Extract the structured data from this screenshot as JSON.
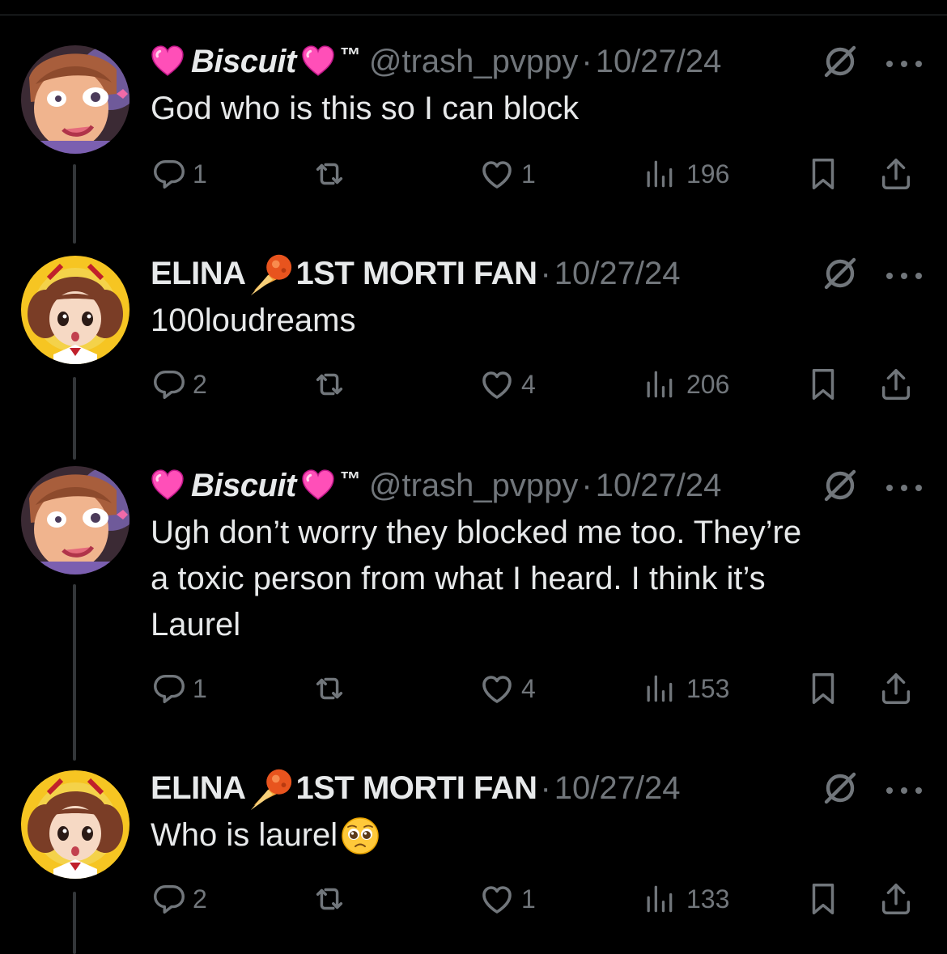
{
  "tweets": [
    {
      "author": "Biscuit",
      "author_prefix_emoji": "pink-heart",
      "author_suffix_emoji": "pink-heart",
      "tm": "™",
      "handle": "@trash_pvppy",
      "separator": "·",
      "date": "10/27/24",
      "text": "God who is this so I can block",
      "replies": "1",
      "likes": "1",
      "views": "196"
    },
    {
      "author": "ELINA",
      "author_middle_emoji": "comet",
      "author_suffix": "1ST MORTI FAN",
      "separator": "·",
      "date": "10/27/24",
      "text": "100loudreams",
      "replies": "2",
      "likes": "4",
      "views": "206"
    },
    {
      "author": "Biscuit",
      "author_prefix_emoji": "pink-heart",
      "author_suffix_emoji": "pink-heart",
      "tm": "™",
      "handle": "@trash_pvppy",
      "separator": "·",
      "date": "10/27/24",
      "text_lines": [
        "Ugh don’t worry they blocked me too. They’re",
        "a toxic person from what I heard. I think it’s",
        "Laurel"
      ],
      "replies": "1",
      "likes": "4",
      "views": "153"
    },
    {
      "author": "ELINA",
      "author_middle_emoji": "comet",
      "author_suffix": "1ST MORTI FAN",
      "separator": "·",
      "date": "10/27/24",
      "text": "Who is laurel",
      "text_emoji": "pleading-face",
      "replies": "2",
      "likes": "1",
      "views": "133"
    }
  ],
  "colors": {
    "background": "#000000",
    "text": "#e7e9ea",
    "muted": "#71767b",
    "thread_line": "#333639"
  },
  "icons": [
    "reply-icon",
    "retweet-icon",
    "like-icon",
    "views-icon",
    "bookmark-icon",
    "share-icon",
    "grok-icon",
    "more-icon"
  ]
}
